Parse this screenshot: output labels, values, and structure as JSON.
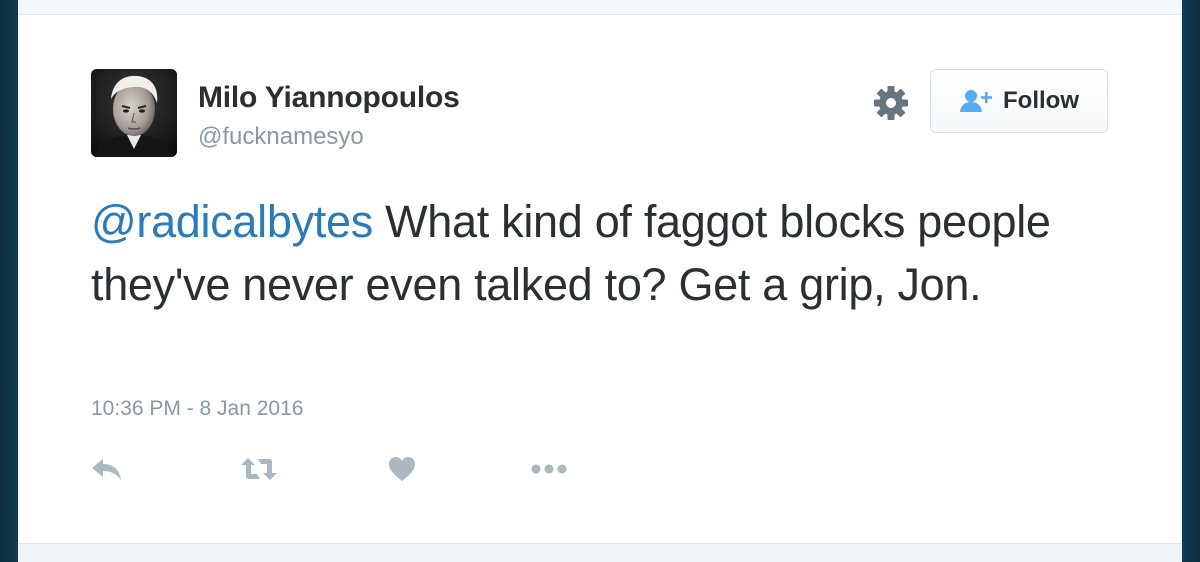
{
  "tweet": {
    "author": {
      "name": "Milo Yiannopoulos",
      "handle": "@fucknamesyo"
    },
    "mention": "@radicalbytes",
    "text": " What kind of faggot blocks people they've never even talked to? Get a grip, Jon.",
    "timestamp": "10:36 PM - 8 Jan 2016"
  },
  "header": {
    "follow_label": "Follow",
    "settings_icon": "gear-icon",
    "follow_icon": "add-user-icon"
  },
  "actions": [
    {
      "name": "reply",
      "icon": "reply-icon"
    },
    {
      "name": "retweet",
      "icon": "retweet-icon"
    },
    {
      "name": "like",
      "icon": "heart-icon"
    },
    {
      "name": "more",
      "icon": "more-icon"
    }
  ],
  "colors": {
    "link": "#2b7bb9",
    "text": "#292f33",
    "muted": "#8899a6",
    "action_icon": "#aab8c2",
    "follow_icon": "#55acee"
  }
}
